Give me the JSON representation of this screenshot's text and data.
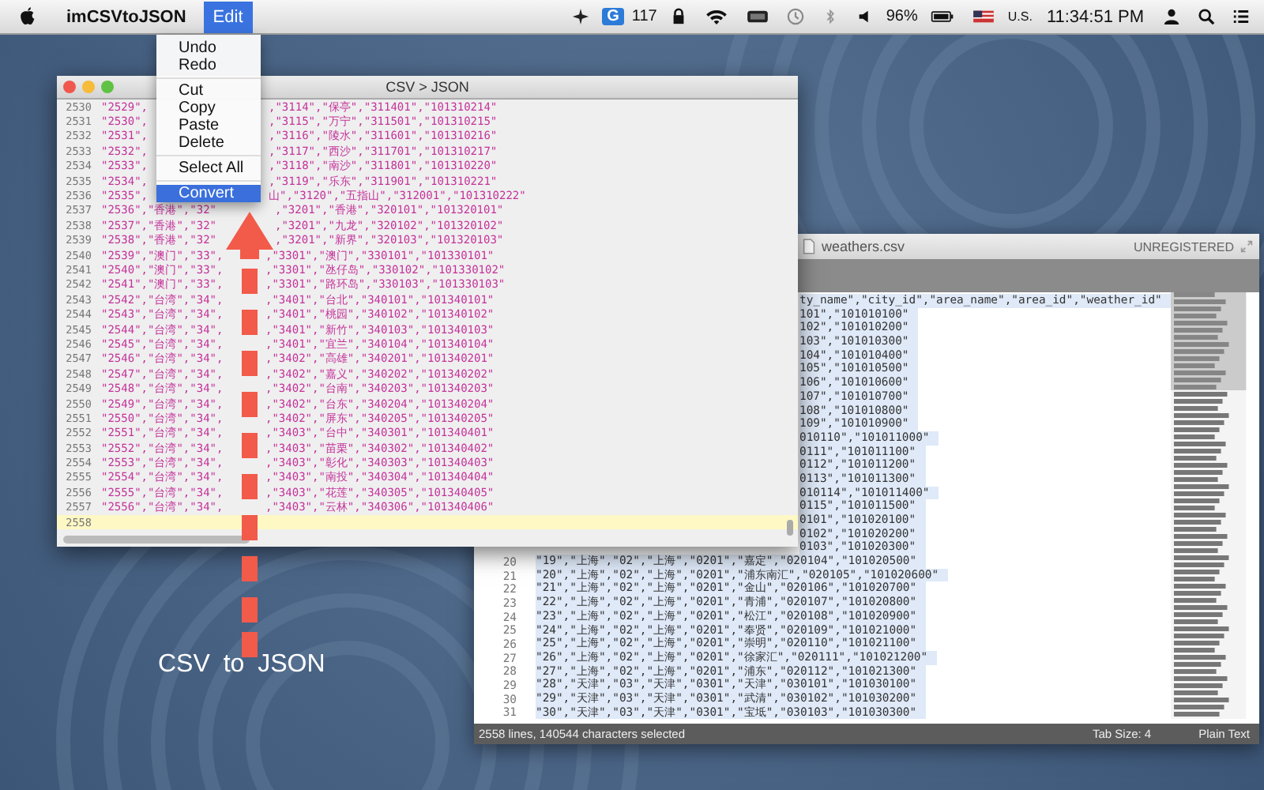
{
  "menu_bar": {
    "items": [
      {
        "label": "imCSVtoJSON",
        "selected": false
      },
      {
        "label": "Edit",
        "selected": true
      }
    ],
    "status": {
      "badge": "G",
      "count": "117",
      "battery": "96%",
      "input_source": "U.S.",
      "clock": "11:34:51 PM"
    }
  },
  "edit_menu": {
    "groups": [
      [
        {
          "label": "Undo",
          "selected": false
        },
        {
          "label": "Redo",
          "selected": false
        }
      ],
      [
        {
          "label": "Cut",
          "selected": false
        },
        {
          "label": "Copy",
          "selected": false
        },
        {
          "label": "Paste",
          "selected": false
        },
        {
          "label": "Delete",
          "selected": false
        }
      ],
      [
        {
          "label": "Select All",
          "selected": false
        }
      ],
      [
        {
          "label": "Convert",
          "selected": true
        }
      ]
    ]
  },
  "converter_window": {
    "title": "CSV > JSON",
    "lines": [
      {
        "num": "2530",
        "kind": "menu",
        "left": "\"2529\",",
        "right": ",\"3114\",\"保亭\",\"311401\",\"101310214\"",
        "current": false
      },
      {
        "num": "2531",
        "kind": "menu",
        "left": "\"2530\",",
        "right": ",\"3115\",\"万宁\",\"311501\",\"101310215\"",
        "current": false
      },
      {
        "num": "2532",
        "kind": "menu",
        "left": "\"2531\",",
        "right": ",\"3116\",\"陵水\",\"311601\",\"101310216\"",
        "current": false
      },
      {
        "num": "2533",
        "kind": "menu",
        "left": "\"2532\",",
        "right": ",\"3117\",\"西沙\",\"311701\",\"101310217\"",
        "current": false
      },
      {
        "num": "2534",
        "kind": "menu",
        "left": "\"2533\",",
        "right": ",\"3118\",\"南沙\",\"311801\",\"101310220\"",
        "current": false
      },
      {
        "num": "2535",
        "kind": "menu",
        "left": "\"2534\",",
        "right": ",\"3119\",\"乐东\",\"311901\",\"101310221\"",
        "current": false
      },
      {
        "num": "2536",
        "kind": "menu",
        "left": "\"2535\",",
        "right": "山\",\"3120\",\"五指山\",\"312001\",\"101310222\"",
        "current": false
      },
      {
        "num": "2537",
        "kind": "head",
        "left": "\"2536\",\"香港\",\"32\"",
        "right": ",\"3201\",\"香港\",\"320101\",\"101320101\"",
        "current": false
      },
      {
        "num": "2538",
        "kind": "head",
        "left": "\"2537\",\"香港\",\"32\"",
        "right": ",\"3201\",\"九龙\",\"320102\",\"101320102\"",
        "current": false
      },
      {
        "num": "2539",
        "kind": "head",
        "left": "\"2538\",\"香港\",\"32\"",
        "right": ",\"3201\",\"新界\",\"320103\",\"101320103\"",
        "current": false
      },
      {
        "num": "2540",
        "kind": "shaft",
        "left": "\"2539\",\"澳门\",\"33\",",
        "right": ",\"3301\",\"澳门\",\"330101\",\"101330101\"",
        "current": false
      },
      {
        "num": "2541",
        "kind": "shaft",
        "left": "\"2540\",\"澳门\",\"33\",",
        "right": ",\"3301\",\"氹仔岛\",\"330102\",\"101330102\"",
        "current": false
      },
      {
        "num": "2542",
        "kind": "shaft",
        "left": "\"2541\",\"澳门\",\"33\",",
        "right": ",\"3301\",\"路环岛\",\"330103\",\"101330103\"",
        "current": false
      },
      {
        "num": "2543",
        "kind": "shaft",
        "left": "\"2542\",\"台湾\",\"34\",",
        "right": ",\"3401\",\"台北\",\"340101\",\"101340101\"",
        "current": false
      },
      {
        "num": "2544",
        "kind": "shaft",
        "left": "\"2543\",\"台湾\",\"34\",",
        "right": ",\"3401\",\"桃园\",\"340102\",\"101340102\"",
        "current": false
      },
      {
        "num": "2545",
        "kind": "shaft",
        "left": "\"2544\",\"台湾\",\"34\",",
        "right": ",\"3401\",\"新竹\",\"340103\",\"101340103\"",
        "current": false
      },
      {
        "num": "2546",
        "kind": "shaft",
        "left": "\"2545\",\"台湾\",\"34\",",
        "right": ",\"3401\",\"宜兰\",\"340104\",\"101340104\"",
        "current": false
      },
      {
        "num": "2547",
        "kind": "shaft",
        "left": "\"2546\",\"台湾\",\"34\",",
        "right": ",\"3402\",\"高雄\",\"340201\",\"101340201\"",
        "current": false
      },
      {
        "num": "2548",
        "kind": "shaft",
        "left": "\"2547\",\"台湾\",\"34\",",
        "right": ",\"3402\",\"嘉义\",\"340202\",\"101340202\"",
        "current": false
      },
      {
        "num": "2549",
        "kind": "shaft",
        "left": "\"2548\",\"台湾\",\"34\",",
        "right": ",\"3402\",\"台南\",\"340203\",\"101340203\"",
        "current": false
      },
      {
        "num": "2550",
        "kind": "shaft",
        "left": "\"2549\",\"台湾\",\"34\",",
        "right": ",\"3402\",\"台东\",\"340204\",\"101340204\"",
        "current": false
      },
      {
        "num": "2551",
        "kind": "shaft",
        "left": "\"2550\",\"台湾\",\"34\",",
        "right": ",\"3402\",\"屏东\",\"340205\",\"101340205\"",
        "current": false
      },
      {
        "num": "2552",
        "kind": "shaft",
        "left": "\"2551\",\"台湾\",\"34\",",
        "right": ",\"3403\",\"台中\",\"340301\",\"101340401\"",
        "current": false
      },
      {
        "num": "2553",
        "kind": "shaft",
        "left": "\"2552\",\"台湾\",\"34\",",
        "right": ",\"3403\",\"苗栗\",\"340302\",\"101340402\"",
        "current": false
      },
      {
        "num": "2554",
        "kind": "shaft",
        "left": "\"2553\",\"台湾\",\"34\",",
        "right": ",\"3403\",\"彰化\",\"340303\",\"101340403\"",
        "current": false
      },
      {
        "num": "2555",
        "kind": "shaft",
        "left": "\"2554\",\"台湾\",\"34\",",
        "right": ",\"3403\",\"南投\",\"340304\",\"101340404\"",
        "current": false
      },
      {
        "num": "2556",
        "kind": "shaft",
        "left": "\"2555\",\"台湾\",\"34\",",
        "right": ",\"3403\",\"花莲\",\"340305\",\"101340405\"",
        "current": false
      },
      {
        "num": "2557",
        "kind": "shaft",
        "left": "\"2556\",\"台湾\",\"34\",",
        "right": ",\"3403\",\"云林\",\"340306\",\"101340406\"",
        "current": false
      },
      {
        "num": "2558",
        "kind": "blank",
        "current": true
      }
    ]
  },
  "editor_window": {
    "title": "weathers.csv",
    "registration": "UNREGISTERED",
    "all_selected": true,
    "lines": [
      {
        "text": "ty_name\",\"city_id\",\"area_name\",\"area_id\",\"weather_id\""
      },
      {
        "text": "101\",\"101010100\""
      },
      {
        "text": "102\",\"101010200\""
      },
      {
        "text": "103\",\"101010300\""
      },
      {
        "text": "104\",\"101010400\""
      },
      {
        "text": "105\",\"101010500\""
      },
      {
        "text": "106\",\"101010600\""
      },
      {
        "text": "107\",\"101010700\""
      },
      {
        "text": "108\",\"101010800\""
      },
      {
        "text": "109\",\"101010900\""
      },
      {
        "text": "010110\",\"101011000\""
      },
      {
        "text": "0111\",\"101011100\""
      },
      {
        "text": "0112\",\"101011200\""
      },
      {
        "text": "0113\",\"101011300\""
      },
      {
        "text": "010114\",\"101011400\""
      },
      {
        "text": "0115\",\"101011500\""
      },
      {
        "text": "0101\",\"101020100\""
      },
      {
        "text": "0102\",\"101020200\""
      },
      {
        "text": "0103\",\"101020300\""
      },
      {
        "num": "20",
        "text": "\"19\",\"上海\",\"02\",\"上海\",\"0201\",\"嘉定\",\"020104\",\"101020500\""
      },
      {
        "num": "21",
        "text": "\"20\",\"上海\",\"02\",\"上海\",\"0201\",\"浦东南汇\",\"020105\",\"101020600\""
      },
      {
        "num": "22",
        "text": "\"21\",\"上海\",\"02\",\"上海\",\"0201\",\"金山\",\"020106\",\"101020700\""
      },
      {
        "num": "23",
        "text": "\"22\",\"上海\",\"02\",\"上海\",\"0201\",\"青浦\",\"020107\",\"101020800\""
      },
      {
        "num": "24",
        "text": "\"23\",\"上海\",\"02\",\"上海\",\"0201\",\"松江\",\"020108\",\"101020900\""
      },
      {
        "num": "25",
        "text": "\"24\",\"上海\",\"02\",\"上海\",\"0201\",\"奉贤\",\"020109\",\"101021000\""
      },
      {
        "num": "26",
        "text": "\"25\",\"上海\",\"02\",\"上海\",\"0201\",\"崇明\",\"020110\",\"101021100\""
      },
      {
        "num": "27",
        "text": "\"26\",\"上海\",\"02\",\"上海\",\"0201\",\"徐家汇\",\"020111\",\"101021200\""
      },
      {
        "num": "28",
        "text": "\"27\",\"上海\",\"02\",\"上海\",\"0201\",\"浦东\",\"020112\",\"101021300\""
      },
      {
        "num": "29",
        "text": "\"28\",\"天津\",\"03\",\"天津\",\"0301\",\"天津\",\"030101\",\"101030100\""
      },
      {
        "num": "30",
        "text": "\"29\",\"天津\",\"03\",\"天津\",\"0301\",\"武清\",\"030102\",\"101030200\""
      },
      {
        "num": "31",
        "text": "\"30\",\"天津\",\"03\",\"天津\",\"0301\",\"宝坻\",\"030103\",\"101030300\""
      }
    ],
    "status_bar": {
      "selection": "2558 lines, 140544 characters selected",
      "tab_size": "Tab Size: 4",
      "syntax": "Plain Text"
    }
  },
  "annotation": {
    "label": "CSV to JSON"
  }
}
